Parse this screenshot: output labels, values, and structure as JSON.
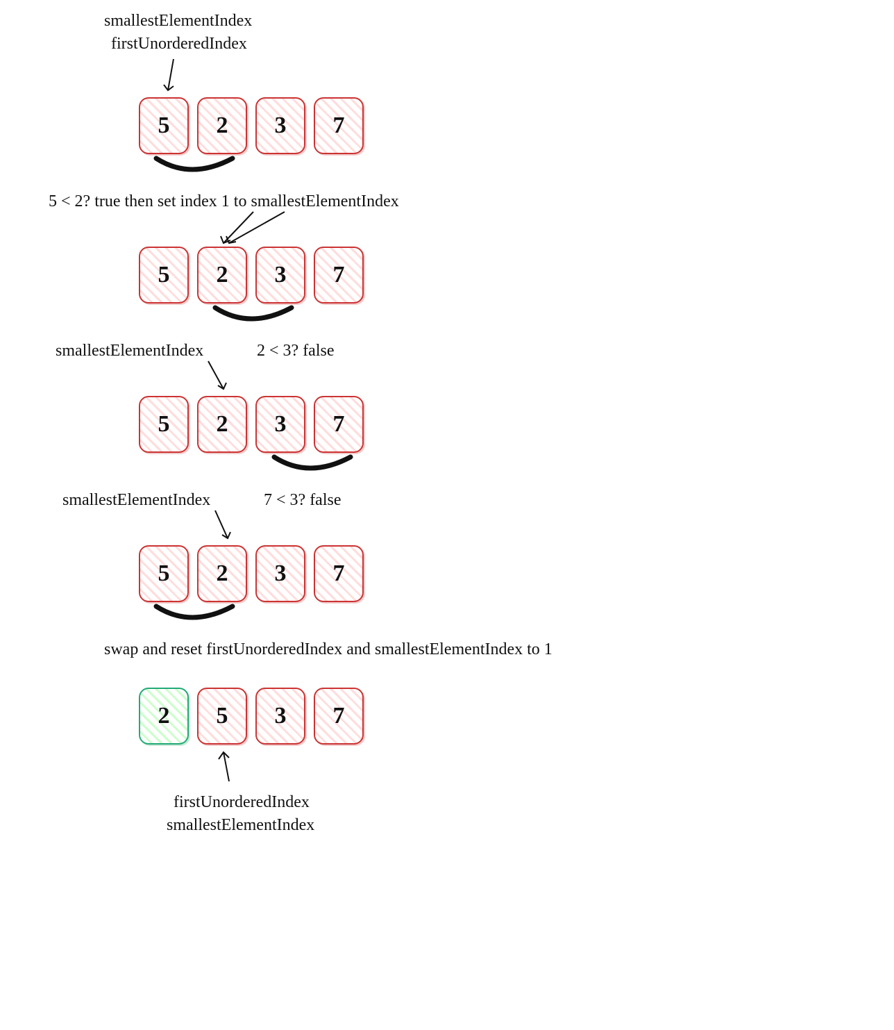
{
  "labels": {
    "sei": "smallestElementIndex",
    "fui": "firstUnorderedIndex",
    "step1_caption": "5 < 2? true then set index 1 to smallestElementIndex",
    "step2_caption_left": "smallestElementIndex",
    "step2_caption_right": "2 < 3? false",
    "step3_caption_left": "smallestElementIndex",
    "step3_caption_right": "7 < 3? false",
    "swap_caption": "swap and reset firstUnorderedIndex and smallestElementIndex to 1",
    "bottom_fui": "firstUnorderedIndex",
    "bottom_sei": "smallestElementIndex"
  },
  "rows": {
    "row1": [
      "5",
      "2",
      "3",
      "7"
    ],
    "row2": [
      "5",
      "2",
      "3",
      "7"
    ],
    "row3": [
      "5",
      "2",
      "3",
      "7"
    ],
    "row4": [
      "5",
      "2",
      "3",
      "7"
    ],
    "row5": [
      "2",
      "5",
      "3",
      "7"
    ]
  },
  "row5_states": [
    "green",
    "red",
    "red",
    "red"
  ]
}
